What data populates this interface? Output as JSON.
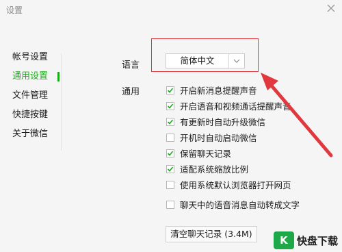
{
  "window": {
    "title": "设置"
  },
  "nav": {
    "items": [
      {
        "label": "帐号设置",
        "active": false
      },
      {
        "label": "通用设置",
        "active": true
      },
      {
        "label": "文件管理",
        "active": false
      },
      {
        "label": "快捷按键",
        "active": false
      },
      {
        "label": "关于微信",
        "active": false
      }
    ]
  },
  "general": {
    "language_label": "语言",
    "language_value": "简体中文",
    "section_label": "通用",
    "options": [
      {
        "label": "开启新消息提醒声音",
        "checked": true
      },
      {
        "label": "开启语音和视频通话提醒声音",
        "checked": true
      },
      {
        "label": "有更新时自动升级微信",
        "checked": true
      },
      {
        "label": "开机时自动启动微信",
        "checked": false
      },
      {
        "label": "保留聊天记录",
        "checked": true
      },
      {
        "label": "适配系统缩放比例",
        "checked": true
      },
      {
        "label": "使用系统默认浏览器打开网页",
        "checked": false
      },
      {
        "label": "聊天中的语音消息自动转成文字",
        "checked": false
      }
    ],
    "clear_button": "清空聊天记录 (3.4M)"
  },
  "annotation": {
    "color": "#e0383e"
  },
  "watermark": {
    "badge": "K",
    "text": "快盘下载"
  },
  "colors": {
    "accent": "#1aad19"
  }
}
